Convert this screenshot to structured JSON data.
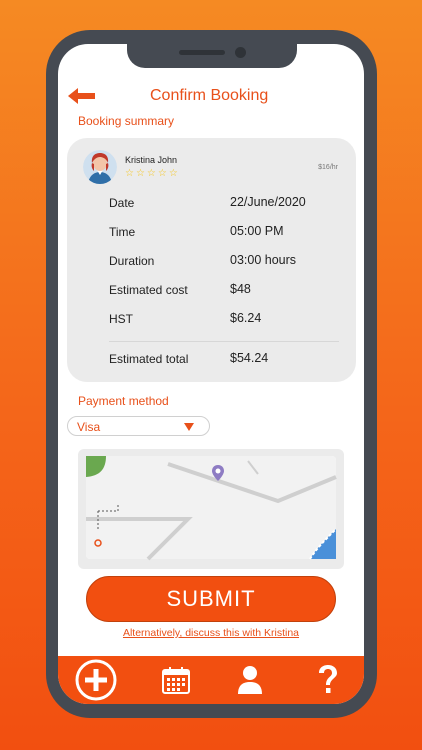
{
  "header": {
    "title": "Confirm Booking",
    "back_icon": "arrow-left-icon"
  },
  "summary": {
    "section_label": "Booking summary",
    "provider": {
      "name": "Kristina John",
      "rating": 0,
      "rate": "$16/hr"
    },
    "rows": [
      {
        "label": "Date",
        "value": "22/June/2020"
      },
      {
        "label": "Time",
        "value": "05:00 PM"
      },
      {
        "label": "Duration",
        "value": "03:00 hours"
      },
      {
        "label": "Estimated cost",
        "value": "$48"
      },
      {
        "label": "HST",
        "value": "$6.24"
      }
    ],
    "total": {
      "label": "Estimated total",
      "value": "$54.24"
    }
  },
  "payment": {
    "section_label": "Payment method",
    "selected": "Visa"
  },
  "map": {
    "icon": "location-pin-icon"
  },
  "actions": {
    "submit_label": "SUBMIT",
    "alt_link": "Alternatively, discuss this with Kristina"
  },
  "tabs": [
    {
      "icon": "plus-icon",
      "active": true
    },
    {
      "icon": "calendar-icon"
    },
    {
      "icon": "user-icon"
    },
    {
      "icon": "help-icon"
    }
  ],
  "colors": {
    "accent": "#f24f10",
    "text_accent": "#e8501a",
    "card": "#ebebeb",
    "star": "#f5c518"
  }
}
